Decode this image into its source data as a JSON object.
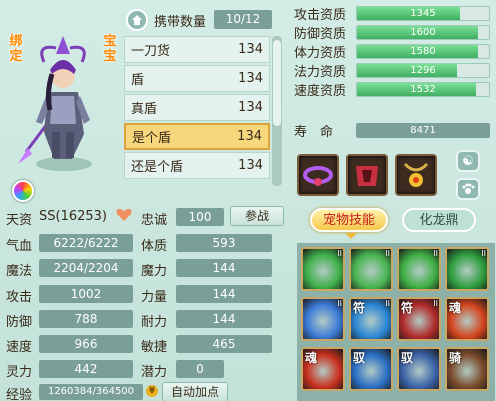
{
  "pet": {
    "bound_tag": "绑定",
    "baby_tag": "宝宝"
  },
  "carry": {
    "label": "携带数量",
    "count": "10/12",
    "items": [
      {
        "name": "一刀货",
        "level": "134",
        "selected": false
      },
      {
        "name": "盾",
        "level": "134",
        "selected": false
      },
      {
        "name": "真盾",
        "level": "134",
        "selected": false
      },
      {
        "name": "是个盾",
        "level": "134",
        "selected": true
      },
      {
        "name": "还是个盾",
        "level": "134",
        "selected": false
      }
    ]
  },
  "attributes": [
    {
      "label": "攻击资质",
      "value": "1345",
      "fill": 0.78
    },
    {
      "label": "防御资质",
      "value": "1600",
      "fill": 0.92
    },
    {
      "label": "体力资质",
      "value": "1580",
      "fill": 0.92
    },
    {
      "label": "法力资质",
      "value": "1296",
      "fill": 0.76
    },
    {
      "label": "速度资质",
      "value": "1532",
      "fill": 0.9
    }
  ],
  "lifespan": {
    "label": "寿　命",
    "value": "8471"
  },
  "stats": {
    "talent_label": "天资",
    "talent_value": "SS(16253)",
    "loyalty_label": "忠诚",
    "loyalty_value": "100",
    "fight_button": "参战",
    "hp_label": "气血",
    "hp_value": "6222/6222",
    "constitution_label": "体质",
    "constitution_value": "593",
    "mp_label": "魔法",
    "mp_value": "2204/2204",
    "magic_label": "魔力",
    "magic_value": "144",
    "attack_label": "攻击",
    "attack_value": "1002",
    "strength_label": "力量",
    "strength_value": "144",
    "defense_label": "防御",
    "defense_value": "788",
    "endurance_label": "耐力",
    "endurance_value": "144",
    "speed_label": "速度",
    "speed_value": "966",
    "agility_label": "敏捷",
    "agility_value": "465",
    "spirit_label": "灵力",
    "spirit_value": "442",
    "potential_label": "潜力",
    "potential_value": "0",
    "exp_label": "经验",
    "exp_value": "1260384/364500",
    "auto_add_button": "自动加点"
  },
  "tabs": {
    "skills": "宠物技能",
    "dragon": "化龙鼎"
  },
  "skills": [
    {
      "char": "",
      "mark": "II",
      "color": "#3fb04a"
    },
    {
      "char": "",
      "mark": "II",
      "color": "#49b552"
    },
    {
      "char": "",
      "mark": "II",
      "color": "#3fae44"
    },
    {
      "char": "",
      "mark": "II",
      "color": "#2f9e3e"
    },
    {
      "char": "",
      "mark": "II",
      "color": "#3b7ad6"
    },
    {
      "char": "符",
      "mark": "II",
      "color": "#2b86d4"
    },
    {
      "char": "符",
      "mark": "II",
      "color": "#b02a2a"
    },
    {
      "char": "魂",
      "mark": "",
      "color": "#d4441c"
    },
    {
      "char": "魂",
      "mark": "",
      "color": "#c9301f"
    },
    {
      "char": "驭",
      "mark": "",
      "color": "#2b6fc4"
    },
    {
      "char": "驭",
      "mark": "",
      "color": "#3b63a8"
    },
    {
      "char": "骑",
      "mark": "",
      "color": "#7a4b2a"
    }
  ]
}
